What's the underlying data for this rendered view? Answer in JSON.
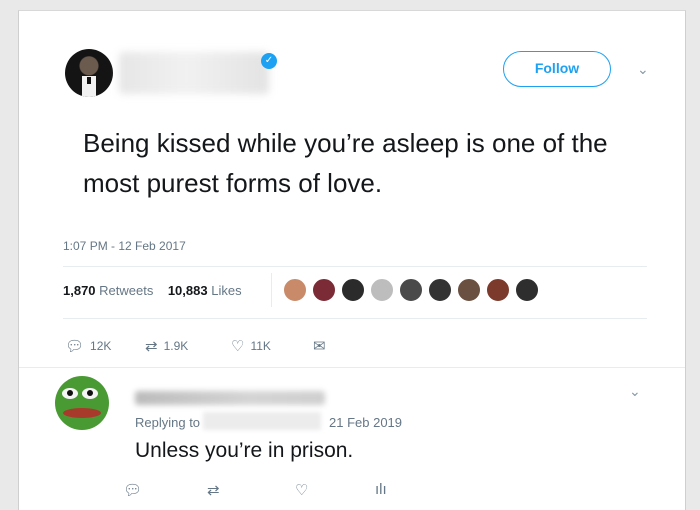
{
  "tweet": {
    "author": {
      "verified": true
    },
    "follow_label": "Follow",
    "text": "Being kissed while you’re asleep is one of the most purest forms of love.",
    "timestamp": "1:07 PM - 12 Feb 2017",
    "stats": {
      "retweets_count": "1,870",
      "retweets_label": "Retweets",
      "likes_count": "10,883",
      "likes_label": "Likes"
    },
    "liker_avatar_colors": [
      "#c98a6a",
      "#7a2b35",
      "#2b2b2b",
      "#bdbdbd",
      "#4a4a4a",
      "#333333",
      "#6a5040",
      "#7b3a2b",
      "#2e2e2e"
    ],
    "actions": {
      "replies": "12K",
      "retweets": "1.9K",
      "likes": "11K"
    },
    "icons": {
      "reply": "reply-icon",
      "retweet": "retweet-icon",
      "like": "heart-icon",
      "message": "envelope-icon",
      "more": "caret-down-icon"
    }
  },
  "reply": {
    "replying_to_label": "Replying to",
    "date": "21 Feb 2019",
    "text": "Unless you’re in prison.",
    "icons": {
      "reply": "reply-icon",
      "retweet": "retweet-icon",
      "like": "heart-icon",
      "analytics": "analytics-icon"
    }
  },
  "colors": {
    "accent": "#1da1f2",
    "text": "#14171a",
    "muted": "#657786"
  }
}
